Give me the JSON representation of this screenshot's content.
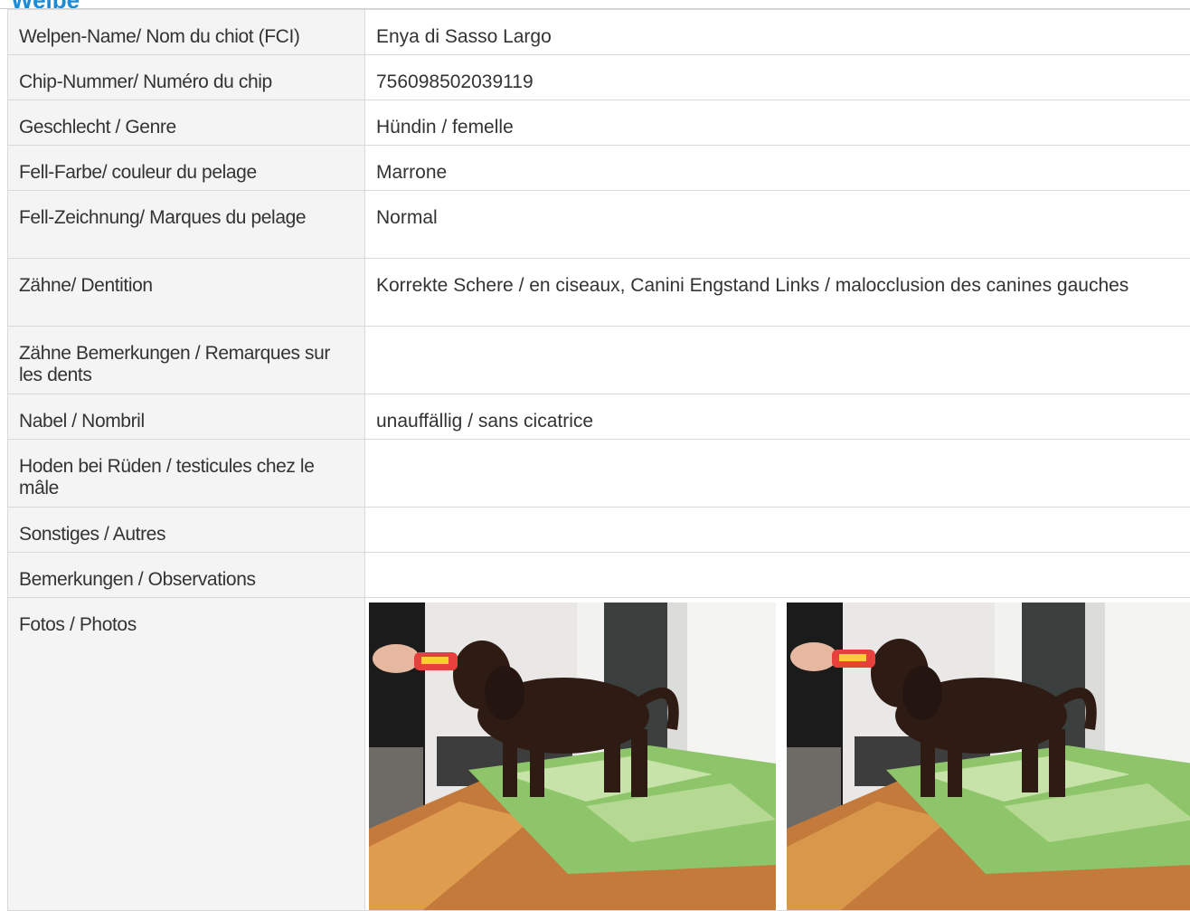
{
  "section": {
    "title": "Welpe"
  },
  "rows": [
    {
      "label": "Welpen-Name/ Nom du chiot (FCI)",
      "value": "Enya di Sasso Largo"
    },
    {
      "label": "Chip-Nummer/ Numéro du chip",
      "value": "756098502039119"
    },
    {
      "label": "Geschlecht / Genre",
      "value": "Hündin / femelle"
    },
    {
      "label": "Fell-Farbe/ couleur du pelage",
      "value": "Marrone"
    },
    {
      "label": "Fell-Zeichnung/ Marques du pelage",
      "value": "Normal"
    },
    {
      "label": "Zähne/ Dentition",
      "value": "Korrekte Schere / en ciseaux, Canini Engstand Links / malocclusion des canines gauches"
    },
    {
      "label": "Zähne Bemerkungen / Remarques sur les dents",
      "value": ""
    },
    {
      "label": "Nabel / Nombril",
      "value": "unauffällig / sans cicatrice"
    },
    {
      "label": "Hoden bei Rüden / testicules chez le mâle",
      "value": ""
    },
    {
      "label": "Sonstiges / Autres",
      "value": ""
    },
    {
      "label": "Bemerkungen / Observations",
      "value": ""
    }
  ],
  "photos": {
    "label": "Fotos / Photos",
    "items": [
      {
        "subject": "brown curly puppy on green mat, fed a treat"
      },
      {
        "subject": "brown curly puppy on green mat, fed a treat"
      }
    ]
  },
  "colors": {
    "heading": "#1a8bd6",
    "label_bg": "#f4f4f4",
    "border": "#d9d9d9"
  }
}
